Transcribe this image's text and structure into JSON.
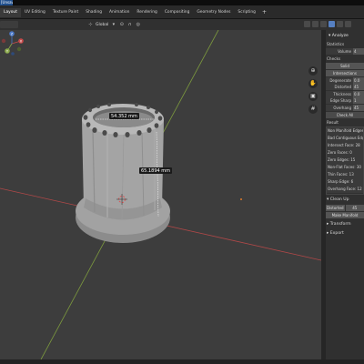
{
  "window": {
    "title": "[Unsaved]"
  },
  "workspace_tabs": [
    {
      "label": "Layout",
      "active": true
    },
    {
      "label": "UV Editing",
      "active": false
    },
    {
      "label": "Texture Paint",
      "active": false
    },
    {
      "label": "Shading",
      "active": false
    },
    {
      "label": "Animation",
      "active": false
    },
    {
      "label": "Rendering",
      "active": false
    },
    {
      "label": "Compositing",
      "active": false
    },
    {
      "label": "Geometry Nodes",
      "active": false
    },
    {
      "label": "Scripting",
      "active": false
    }
  ],
  "tab_add_label": "+",
  "viewport_header": {
    "orientation": "Global",
    "pivot_icon": "pivot-icon",
    "snap_icon": "magnet-icon",
    "proportional_icon": "proportional-icon"
  },
  "viewport": {
    "measurements": {
      "diameter": "54.352 mm",
      "height": "65.1894 mm"
    },
    "gizmo_axes": {
      "x": "X",
      "y": "Y",
      "z": "Z"
    },
    "colors": {
      "x_axis": "#c84a4a",
      "y_axis": "#8aa84a",
      "z_axis": "#4a78c8",
      "background": "#3d3d3d"
    },
    "nav_icons": [
      "zoom-icon",
      "hand-icon",
      "camera-icon",
      "grid-icon"
    ]
  },
  "sidebar": {
    "panel_title": "Analyze",
    "statistics_label": "Statistics",
    "statistics": [
      {
        "key": "Volume",
        "value": "4"
      }
    ],
    "checks_label": "Checks",
    "solid_button": "Solid",
    "intersections_button": "Intersections",
    "checks": [
      {
        "key": "Degenerate",
        "value": "0.0"
      },
      {
        "key": "Distorted",
        "value": "45"
      },
      {
        "key": "Thickness",
        "value": "0.0"
      },
      {
        "key": "Edge Sharp",
        "value": "1"
      },
      {
        "key": "Overhang",
        "value": "45"
      }
    ],
    "check_all_button": "Check All",
    "result_label": "Result",
    "results": [
      "Non Manifold Edges: 1",
      "Bad Contiguous Edges:",
      "Intersect Face: 28",
      "Zero Faces: 0",
      "Zero Edges: 15",
      "Non-Flat Faces: 30",
      "Thin Faces: 13",
      "Sharp Edge: 6",
      "Overhang Face: 12"
    ],
    "cleanup_label": "Clean Up",
    "distorted_button": "Distorted",
    "cleanup_value": "45",
    "make_manifold_button": "Make Manifold",
    "transform_label": "Transform",
    "export_label": "Export"
  }
}
